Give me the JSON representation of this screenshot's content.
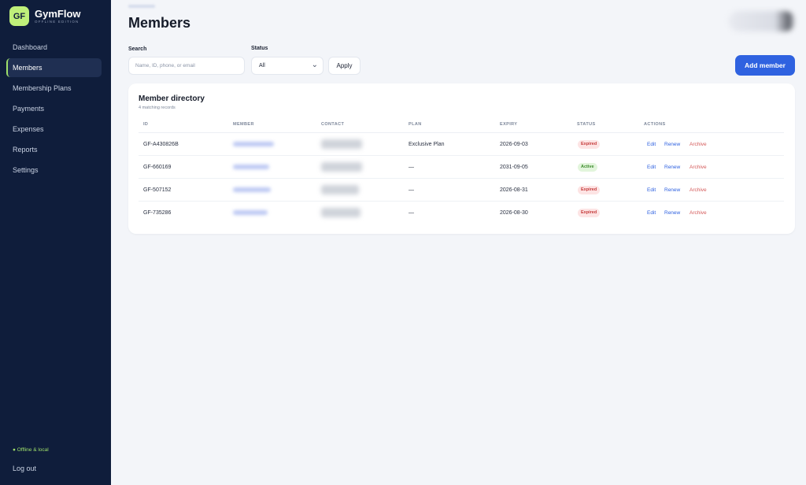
{
  "brand": {
    "logo_text": "GF",
    "name": "GymFlow",
    "edition": "OFFLINE EDITION"
  },
  "sidebar": {
    "items": [
      {
        "label": "Dashboard",
        "active": false
      },
      {
        "label": "Members",
        "active": true
      },
      {
        "label": "Membership Plans",
        "active": false
      },
      {
        "label": "Payments",
        "active": false
      },
      {
        "label": "Expenses",
        "active": false
      },
      {
        "label": "Reports",
        "active": false
      },
      {
        "label": "Settings",
        "active": false
      }
    ],
    "status": "● Offline & local",
    "logout": "Log out"
  },
  "page": {
    "title": "Members"
  },
  "filters": {
    "search_label": "Search",
    "search_placeholder": "Name, ID, phone, or email",
    "search_value": "",
    "status_label": "Status",
    "status_value": "All",
    "apply_label": "Apply"
  },
  "add_button": "Add member",
  "directory": {
    "title": "Member directory",
    "subtitle": "4 matching records",
    "columns": [
      "ID",
      "MEMBER",
      "CONTACT",
      "PLAN",
      "EXPIRY",
      "STATUS",
      "ACTIONS"
    ],
    "rows": [
      {
        "id": "GF-A430826B",
        "plan": "Exclusive Plan",
        "expiry": "2026-09-03",
        "status": "Expired"
      },
      {
        "id": "GF-660169",
        "plan": "—",
        "expiry": "2031-09-05",
        "status": "Active"
      },
      {
        "id": "GF-507152",
        "plan": "—",
        "expiry": "2026-08-31",
        "status": "Expired"
      },
      {
        "id": "GF-735286",
        "plan": "—",
        "expiry": "2026-08-30",
        "status": "Expired"
      }
    ],
    "actions": {
      "edit": "Edit",
      "renew": "Renew",
      "archive": "Archive"
    }
  },
  "colors": {
    "sidebar_bg": "#0f1d3b",
    "accent": "#2f62e0",
    "brand": "#bff07a",
    "expired": "#c53a3a",
    "active": "#3b8a2a"
  }
}
